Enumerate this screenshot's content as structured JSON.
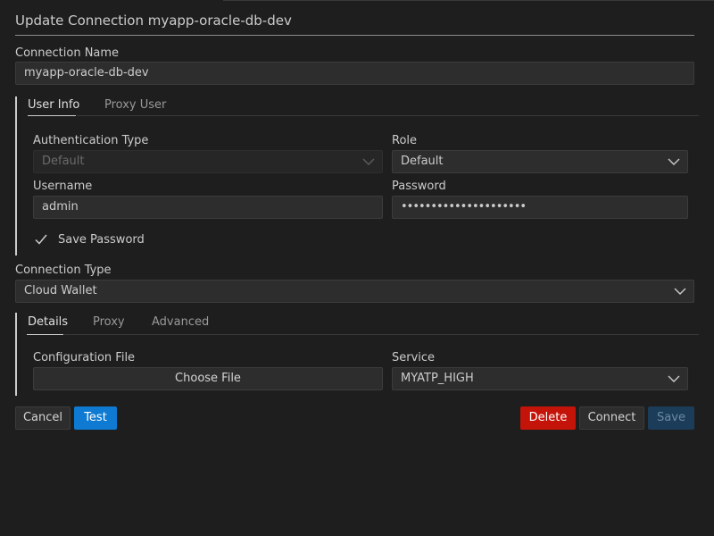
{
  "dialog": {
    "title": "Update Connection myapp-oracle-db-dev"
  },
  "connection_name": {
    "label": "Connection Name",
    "value": "myapp-oracle-db-dev"
  },
  "user_tabs": [
    {
      "label": "User Info",
      "active": true
    },
    {
      "label": "Proxy User",
      "active": false
    }
  ],
  "auth": {
    "type_label": "Authentication Type",
    "type_value": "Default",
    "role_label": "Role",
    "role_value": "Default",
    "username_label": "Username",
    "username_value": "admin",
    "password_label": "Password",
    "password_value": "•••••••••••••••••••••",
    "save_password_label": "Save Password",
    "save_password_checked": true
  },
  "connection_type": {
    "label": "Connection Type",
    "value": "Cloud Wallet"
  },
  "detail_tabs": [
    {
      "label": "Details",
      "active": true
    },
    {
      "label": "Proxy",
      "active": false
    },
    {
      "label": "Advanced",
      "active": false
    }
  ],
  "details": {
    "config_label": "Configuration File",
    "choose_file": "Choose File",
    "service_label": "Service",
    "service_value": "MYATP_HIGH"
  },
  "buttons": {
    "cancel": "Cancel",
    "test": "Test",
    "delete": "Delete",
    "connect": "Connect",
    "save": "Save"
  },
  "colors": {
    "background": "#1e1e1e",
    "primary": "#0e7ad1",
    "danger": "#c4140a",
    "disabled_primary": "#1b3d59"
  }
}
